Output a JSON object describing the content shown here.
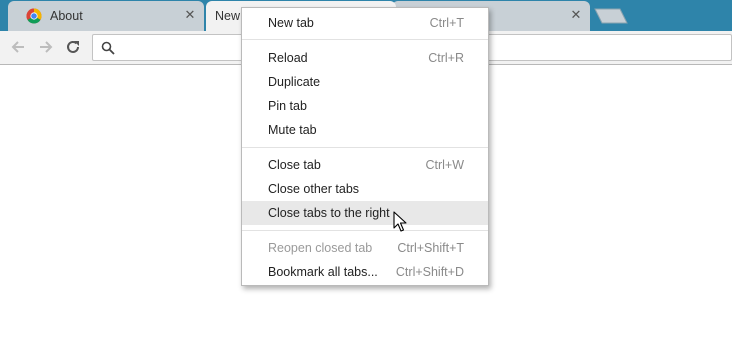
{
  "tabs": [
    {
      "title": "About",
      "favicon": "chrome-logo-icon",
      "close_glyph": "✕"
    },
    {
      "title": "New",
      "active": true
    },
    {
      "title": "",
      "close_glyph": "✕"
    }
  ],
  "toolbar": {
    "back_icon": "back-arrow-icon",
    "forward_icon": "forward-arrow-icon",
    "reload_icon": "reload-icon",
    "omnibox_icon": "search-icon"
  },
  "context_menu": {
    "new_tab": {
      "label": "New tab",
      "shortcut": "Ctrl+T"
    },
    "reload": {
      "label": "Reload",
      "shortcut": "Ctrl+R"
    },
    "duplicate": {
      "label": "Duplicate"
    },
    "pin_tab": {
      "label": "Pin tab"
    },
    "mute_tab": {
      "label": "Mute tab"
    },
    "close_tab": {
      "label": "Close tab",
      "shortcut": "Ctrl+W"
    },
    "close_other_tabs": {
      "label": "Close other tabs"
    },
    "close_tabs_right": {
      "label": "Close tabs to the right",
      "hovered": true
    },
    "reopen_closed_tab": {
      "label": "Reopen closed tab",
      "shortcut": "Ctrl+Shift+T",
      "disabled": true
    },
    "bookmark_all_tabs": {
      "label": "Bookmark all tabs...",
      "shortcut": "Ctrl+Shift+D"
    }
  },
  "colors": {
    "tabstrip": "#2e84aa",
    "active_tab": "#f2f2f2",
    "inactive_tab": "#c8d0d6",
    "menu_hover": "#e8e8e8"
  }
}
